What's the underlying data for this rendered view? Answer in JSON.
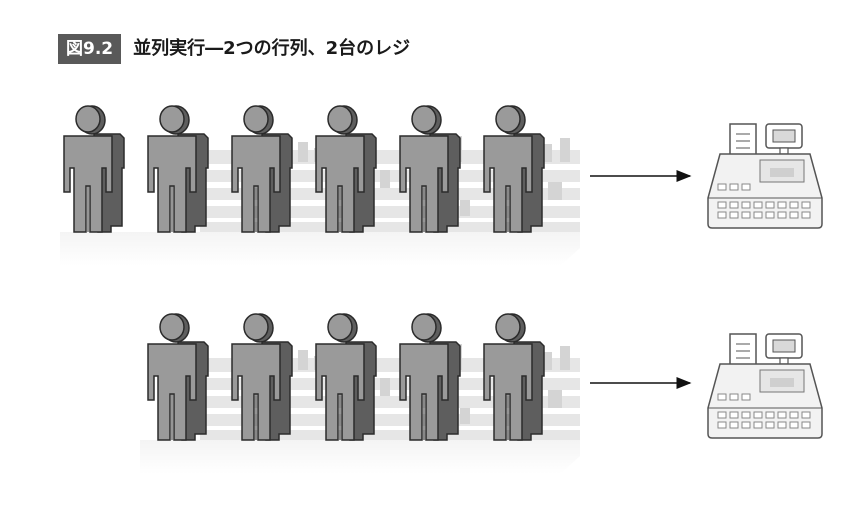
{
  "figure": {
    "number": "図9.2",
    "title": "並列実行―2つの行列、2台のレジ"
  },
  "lanes": [
    {
      "people_count": 6
    },
    {
      "people_count": 5
    }
  ],
  "colors": {
    "person_fill": "#9a9a9a",
    "person_shade": "#5e5e5e",
    "outline": "#2b2b2b",
    "register_fill": "#f2f2f2",
    "register_outline": "#555555",
    "arrow": "#111111",
    "badge": "#595959",
    "floor": "#eeeeee"
  },
  "icons": [
    "person-icon",
    "cash-register-icon",
    "arrow-right-icon"
  ]
}
